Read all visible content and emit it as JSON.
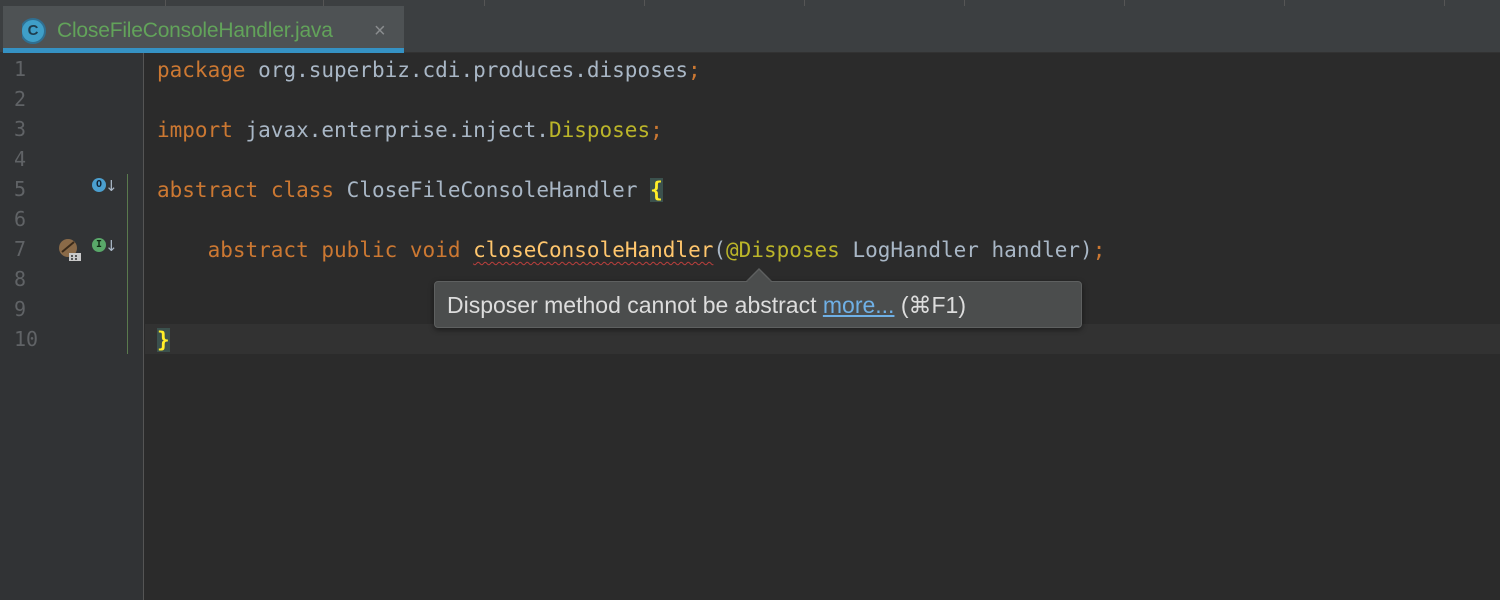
{
  "tab": {
    "icon_letter": "C",
    "file_name": "CloseFileConsoleHandler.java",
    "close_glyph": "×"
  },
  "gutter": {
    "line_numbers": [
      "1",
      "2",
      "3",
      "4",
      "5",
      "6",
      "7",
      "8",
      "9",
      "10"
    ],
    "class_override_icon_letter": "O",
    "method_impl_icon_letter": "I",
    "arrow_glyph": "↓"
  },
  "code": {
    "line1": {
      "kw": "package",
      "rest": " org.superbiz.cdi.produces.disposes",
      "semi": ";"
    },
    "line3": {
      "kw": "import",
      "rest": " javax.enterprise.inject.",
      "cls": "Disposes",
      "semi": ";"
    },
    "line5": {
      "kw1": "abstract",
      "kw2": "class",
      "name": " CloseFileConsoleHandler ",
      "brace": "{"
    },
    "line7": {
      "indent": "    ",
      "kw1": "abstract",
      "kw2": "public",
      "kw3": "void",
      "method": "closeConsoleHandler",
      "open": "(",
      "annotation": "@Disposes",
      "rest": " LogHandler handler)",
      "semi": ";"
    },
    "line10": {
      "brace": "}"
    }
  },
  "tooltip": {
    "message": "Disposer method cannot be abstract ",
    "link": "more...",
    "shortcut": " (⌘F1)"
  },
  "colors": {
    "background": "#2b2b2b",
    "keyword": "#cc7832",
    "annotation": "#bbb529",
    "method": "#ffc66d",
    "text": "#a9b7c6"
  }
}
